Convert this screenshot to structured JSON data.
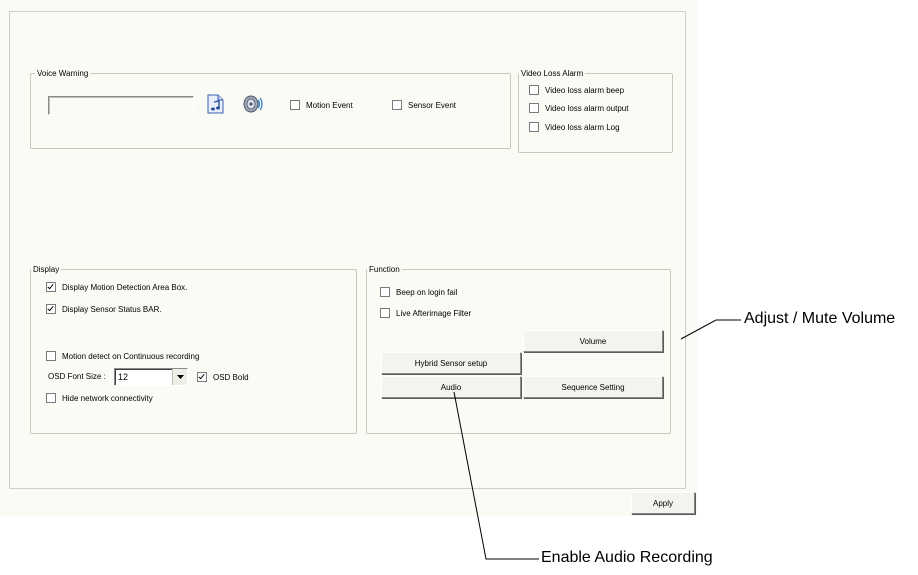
{
  "voice_warning": {
    "title": "Voice Warning",
    "motion_event": "Motion Event",
    "sensor_event": "Sensor Event",
    "file_icon": "music-file-icon",
    "speaker_icon": "speaker-icon"
  },
  "video_loss_alarm": {
    "title": "Video Loss Alarm",
    "items": [
      "Video loss alarm beep",
      "Video loss alarm output",
      "Video loss alarm Log"
    ]
  },
  "display": {
    "title": "Display",
    "motion_box": "Display Motion Detection Area Box.",
    "sensor_bar": "Display Sensor Status BAR.",
    "motion_continuous": "Motion detect on Continuous recording",
    "font_size_label": "OSD Font Size :",
    "font_size_value": "12",
    "osd_bold": "OSD Bold",
    "hide_network": "Hide network connectivity"
  },
  "function": {
    "title": "Function",
    "beep_login": "Beep on login fail",
    "afterimage": "Live Afterimage Filter",
    "volume": "Volume",
    "hybrid_sensor": "Hybrid Sensor setup",
    "audio": "Audio",
    "sequence": "Sequence Setting"
  },
  "apply": "Apply",
  "callouts": {
    "volume": "Adjust / Mute Volume",
    "audio": "Enable Audio Recording"
  },
  "colors": {
    "panel_bg": "#fbfbf5",
    "border": "#c8c8bf",
    "button_face": "#f4f4ee"
  }
}
